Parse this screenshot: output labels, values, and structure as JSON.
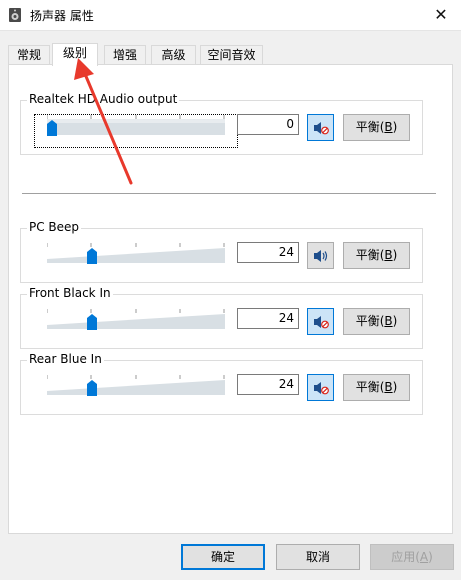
{
  "window": {
    "title": "扬声器 属性",
    "close_glyph": "✕"
  },
  "tabs": [
    {
      "label": "常规",
      "active": false
    },
    {
      "label": "级别",
      "active": true
    },
    {
      "label": "增强",
      "active": false
    },
    {
      "label": "高级",
      "active": false
    },
    {
      "label": "空间音效",
      "active": false
    }
  ],
  "channels": [
    {
      "name": "Realtek HD Audio output",
      "value": "0",
      "level_percent": 0,
      "muted": true,
      "balance_label": "平衡(",
      "balance_key": "B",
      "balance_suffix": ")"
    },
    {
      "name": "PC Beep",
      "value": "24",
      "level_percent": 24,
      "muted": false,
      "balance_label": "平衡(",
      "balance_key": "B",
      "balance_suffix": ")"
    },
    {
      "name": "Front Black In",
      "value": "24",
      "level_percent": 24,
      "muted": true,
      "balance_label": "平衡(",
      "balance_key": "B",
      "balance_suffix": ")"
    },
    {
      "name": "Rear Blue In",
      "value": "24",
      "level_percent": 24,
      "muted": true,
      "balance_label": "平衡(",
      "balance_key": "B",
      "balance_suffix": ")"
    }
  ],
  "buttons": {
    "ok": "确定",
    "cancel": "取消",
    "apply_label": "应用(",
    "apply_key": "A",
    "apply_suffix": ")"
  },
  "colors": {
    "accent": "#0078d7",
    "thumb": "#0078d7",
    "track": "#d8dfe4",
    "annotation_arrow": "#e8392c"
  },
  "icons": {
    "window": "speaker-icon",
    "mute": "speaker-muted-icon",
    "sound": "speaker-on-icon"
  }
}
